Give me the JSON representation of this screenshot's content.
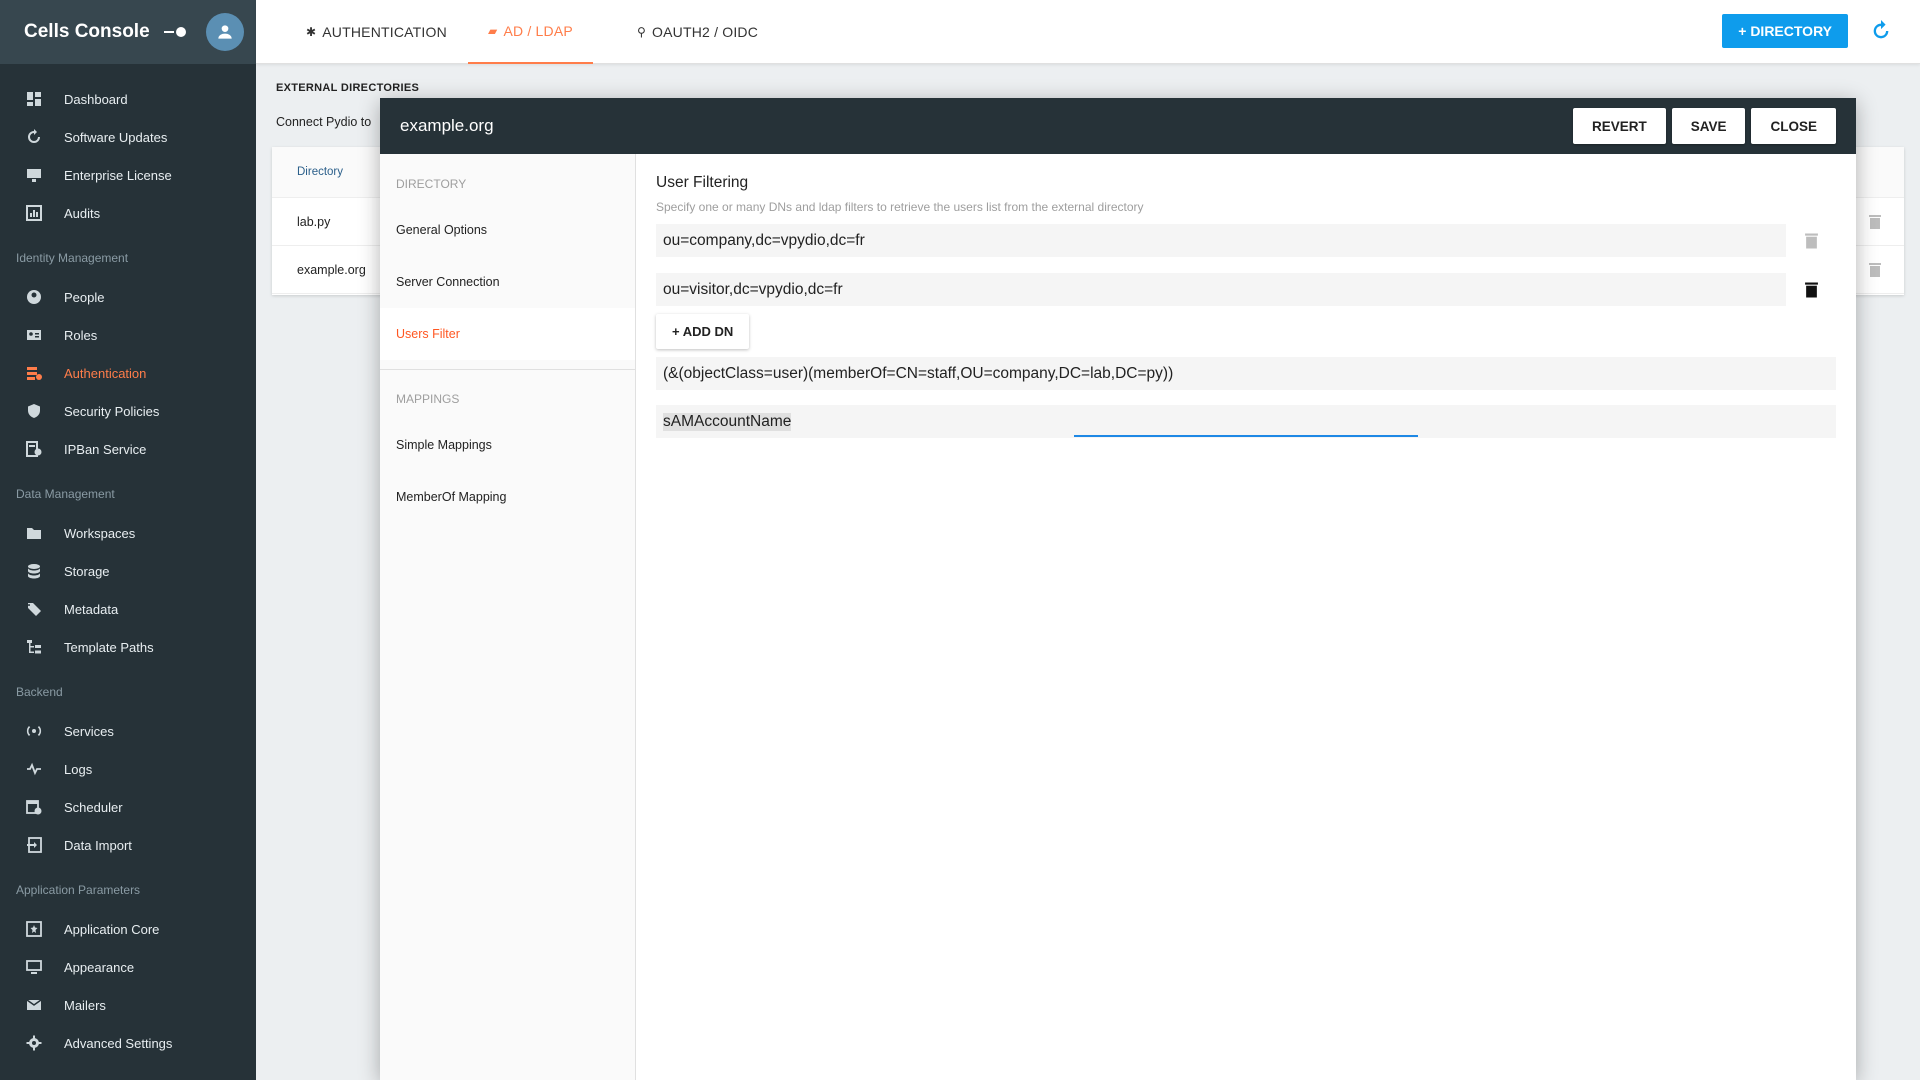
{
  "sidebar": {
    "title": "Cells Console",
    "sections": [
      {
        "label": "",
        "items": [
          {
            "label": "Dashboard",
            "icon": "dashboard-icon"
          },
          {
            "label": "Software Updates",
            "icon": "update-icon"
          },
          {
            "label": "Enterprise License",
            "icon": "license-icon"
          },
          {
            "label": "Audits",
            "icon": "audits-icon"
          }
        ]
      },
      {
        "label": "Identity Management",
        "items": [
          {
            "label": "People",
            "icon": "person-icon"
          },
          {
            "label": "Roles",
            "icon": "roles-icon"
          },
          {
            "label": "Authentication",
            "icon": "authentication-icon",
            "active": true
          },
          {
            "label": "Security Policies",
            "icon": "shield-icon"
          },
          {
            "label": "IPBan Service",
            "icon": "ipban-icon"
          }
        ]
      },
      {
        "label": "Data Management",
        "items": [
          {
            "label": "Workspaces",
            "icon": "folder-icon"
          },
          {
            "label": "Storage",
            "icon": "database-icon"
          },
          {
            "label": "Metadata",
            "icon": "tags-icon"
          },
          {
            "label": "Template Paths",
            "icon": "file-tree-icon"
          }
        ]
      },
      {
        "label": "Backend",
        "items": [
          {
            "label": "Services",
            "icon": "services-icon"
          },
          {
            "label": "Logs",
            "icon": "pulse-icon"
          },
          {
            "label": "Scheduler",
            "icon": "scheduler-icon"
          },
          {
            "label": "Data Import",
            "icon": "import-icon"
          }
        ]
      },
      {
        "label": "Application Parameters",
        "items": [
          {
            "label": "Application Core",
            "icon": "app-core-icon"
          },
          {
            "label": "Appearance",
            "icon": "monitor-icon"
          },
          {
            "label": "Mailers",
            "icon": "mail-icon"
          },
          {
            "label": "Advanced Settings",
            "icon": "gear-icon"
          }
        ]
      }
    ]
  },
  "topbar": {
    "tabs": [
      {
        "label": "AUTHENTICATION",
        "icon": "gear-icon"
      },
      {
        "label": "AD / LDAP",
        "icon": "ldap-icon",
        "active": true
      },
      {
        "label": "OAUTH2 / OIDC",
        "icon": "oauth-icon"
      }
    ],
    "add_directory": "+ DIRECTORY"
  },
  "page": {
    "title": "EXTERNAL DIRECTORIES",
    "description": "Connect Pydio to",
    "table_header": "Directory",
    "rows": [
      "lab.py",
      "example.org"
    ]
  },
  "modal": {
    "title": "example.org",
    "buttons": {
      "revert": "REVERT",
      "save": "SAVE",
      "close": "CLOSE"
    },
    "side": {
      "section1": "DIRECTORY",
      "items1": [
        "General Options",
        "Server Connection",
        "Users Filter"
      ],
      "section2": "MAPPINGS",
      "items2": [
        "Simple Mappings",
        "MemberOf Mapping"
      ]
    },
    "main": {
      "title": "User Filtering",
      "description": "Specify one or many DNs and ldap filters to retrieve the users list from the external directory",
      "dns": [
        "ou=company,dc=vpydio,dc=fr",
        "ou=visitor,dc=vpydio,dc=fr"
      ],
      "add_dn": "+ ADD DN",
      "filter": "(&(objectClass=user)(memberOf=CN=staff,OU=company,DC=lab,DC=py))",
      "login_attribute": "sAMAccountName"
    }
  },
  "colors": {
    "accent": "#ff7d4a",
    "sidebar_bg": "#263238",
    "primary_button": "#0e9cec",
    "focus_underline": "#1e88e5"
  }
}
